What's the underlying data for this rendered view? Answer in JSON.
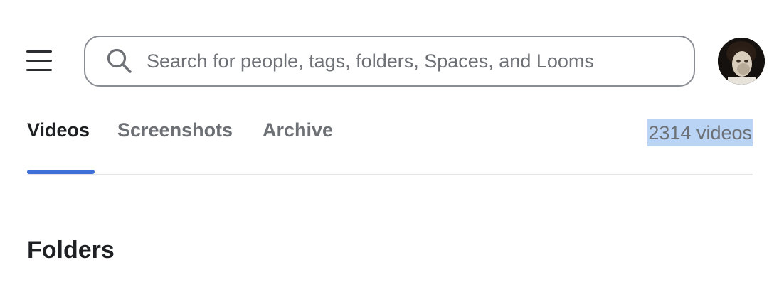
{
  "header": {
    "menu_icon": "hamburger-icon",
    "search": {
      "icon": "search-icon",
      "placeholder": "Search for people, tags, folders, Spaces, and Looms",
      "value": ""
    },
    "avatar": {
      "icon": "user-avatar"
    }
  },
  "tabs": {
    "items": [
      {
        "label": "Videos",
        "active": true
      },
      {
        "label": "Screenshots",
        "active": false
      },
      {
        "label": "Archive",
        "active": false
      }
    ],
    "count_label": "2314 videos",
    "accent_color": "#3f6fd8",
    "selection_highlight": "#b9d4f5"
  },
  "main": {
    "section_title": "Folders"
  }
}
